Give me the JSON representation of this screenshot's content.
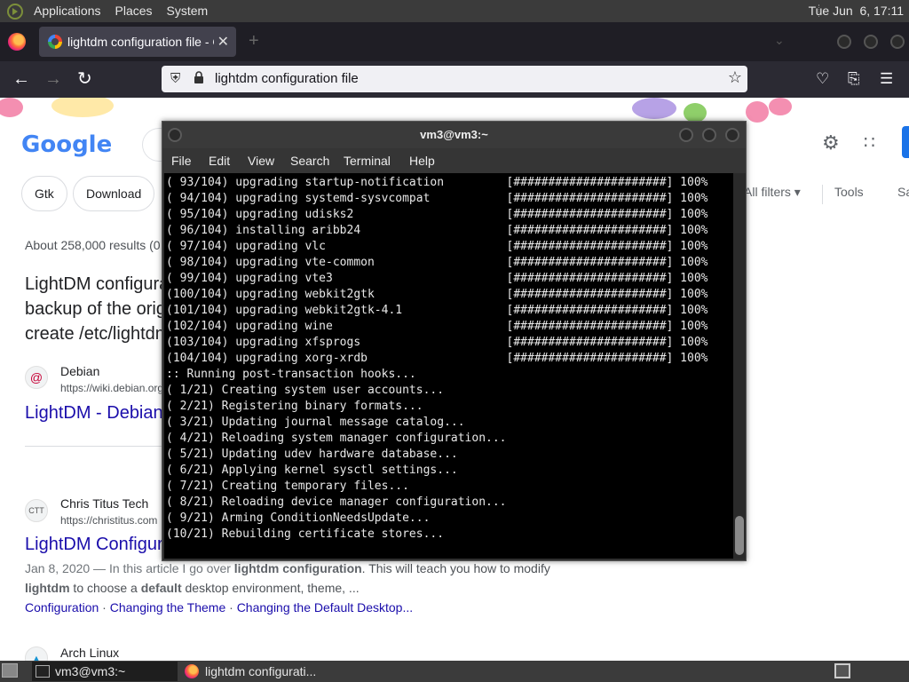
{
  "top_panel": {
    "menus": [
      "Applications",
      "Places",
      "System"
    ],
    "clock": "Tue Jun  6, 17:11"
  },
  "browser": {
    "tab_title": "lightdm configuration file - G",
    "tab_close": "✕",
    "new_tab": "+",
    "url": "lightdm configuration file"
  },
  "google": {
    "logo": "Google",
    "chips": [
      "Gtk",
      "Download"
    ],
    "right_tools": [
      "All filters ▾",
      "Tools",
      "Sa"
    ],
    "results_count": "About 258,000 results (0",
    "snippet_lines": [
      "LightDM configura",
      "backup of the origi",
      "create /etc/lightdm"
    ],
    "results": [
      {
        "site": "Debian",
        "url": "https://wiki.debian.org",
        "title": "LightDM - Debian",
        "icon": "debian"
      },
      {
        "site": "Chris Titus Tech",
        "url": "https://christitus.com",
        "title": "LightDM Configur",
        "icon": "CTT"
      },
      {
        "site": "Arch Linux",
        "url": "",
        "title": "",
        "icon": "arch"
      }
    ],
    "ctt_snippet_1_pre": "Jan 8, 2020 — In this article I go over ",
    "ctt_snippet_1_bold": "lightdm configuration",
    "ctt_snippet_1_post": ". This will teach you how to modify",
    "ctt_snippet_2_bold1": "lightdm",
    "ctt_snippet_2_mid": " to choose a ",
    "ctt_snippet_2_bold2": "default",
    "ctt_snippet_2_post": " desktop environment, theme, ...",
    "ctt_links": [
      "Configuration",
      "Changing the Theme",
      "Changing the Default Desktop..."
    ],
    "ctt_sep": " · "
  },
  "terminal": {
    "title": "vm3@vm3:~",
    "menu": [
      "File",
      "Edit",
      "View",
      "Search",
      "Terminal",
      "Help"
    ],
    "lines": [
      "( 93/104) upgrading startup-notification         [######################] 100%",
      "( 94/104) upgrading systemd-sysvcompat           [######################] 100%",
      "( 95/104) upgrading udisks2                      [######################] 100%",
      "( 96/104) installing aribb24                     [######################] 100%",
      "( 97/104) upgrading vlc                          [######################] 100%",
      "( 98/104) upgrading vte-common                   [######################] 100%",
      "( 99/104) upgrading vte3                         [######################] 100%",
      "(100/104) upgrading webkit2gtk                   [######################] 100%",
      "(101/104) upgrading webkit2gtk-4.1               [######################] 100%",
      "(102/104) upgrading wine                         [######################] 100%",
      "(103/104) upgrading xfsprogs                     [######################] 100%",
      "(104/104) upgrading xorg-xrdb                    [######################] 100%",
      ":: Running post-transaction hooks...",
      "( 1/21) Creating system user accounts...",
      "( 2/21) Registering binary formats...",
      "( 3/21) Updating journal message catalog...",
      "( 4/21) Reloading system manager configuration...",
      "( 5/21) Updating udev hardware database...",
      "( 6/21) Applying kernel sysctl settings...",
      "( 7/21) Creating temporary files...",
      "( 8/21) Reloading device manager configuration...",
      "( 9/21) Arming ConditionNeedsUpdate...",
      "(10/21) Rebuilding certificate stores..."
    ]
  },
  "taskbar": {
    "tasks": [
      "vm3@vm3:~",
      "lightdm configurati..."
    ]
  }
}
